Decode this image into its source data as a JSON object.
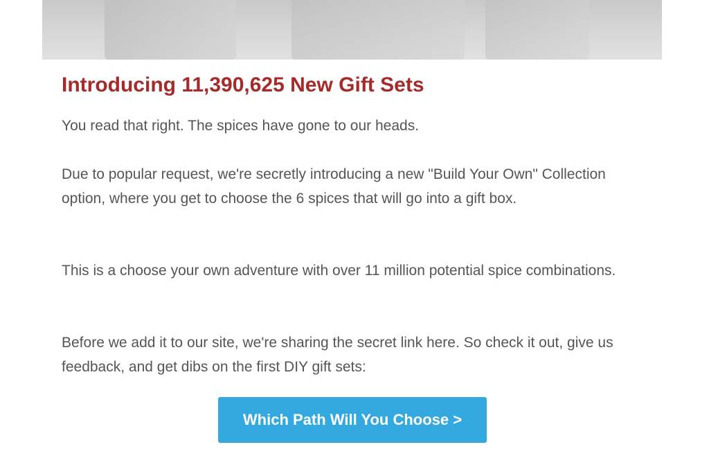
{
  "hero": {
    "image_alt": "spice gift boxes"
  },
  "headline": "Introducing 11,390,625 New Gift Sets",
  "paragraphs": {
    "p1": "You read that right. The spices have gone to our heads.",
    "p2": "Due to popular request, we're secretly introducing a new \"Build Your Own\" Collection option, where you get to choose the 6 spices that will go into a gift box.",
    "p3": "This is a choose your own adventure with over 11 million potential spice combinations.",
    "p4": "Before we add it to our site, we're sharing the secret link here. So check it out, give us feedback, and get dibs on the first DIY gift sets:"
  },
  "cta": {
    "label": "Which Path Will You Choose >"
  },
  "colors": {
    "headline": "#a62a2a",
    "body_text": "#555555",
    "button": "#34a9e0"
  }
}
